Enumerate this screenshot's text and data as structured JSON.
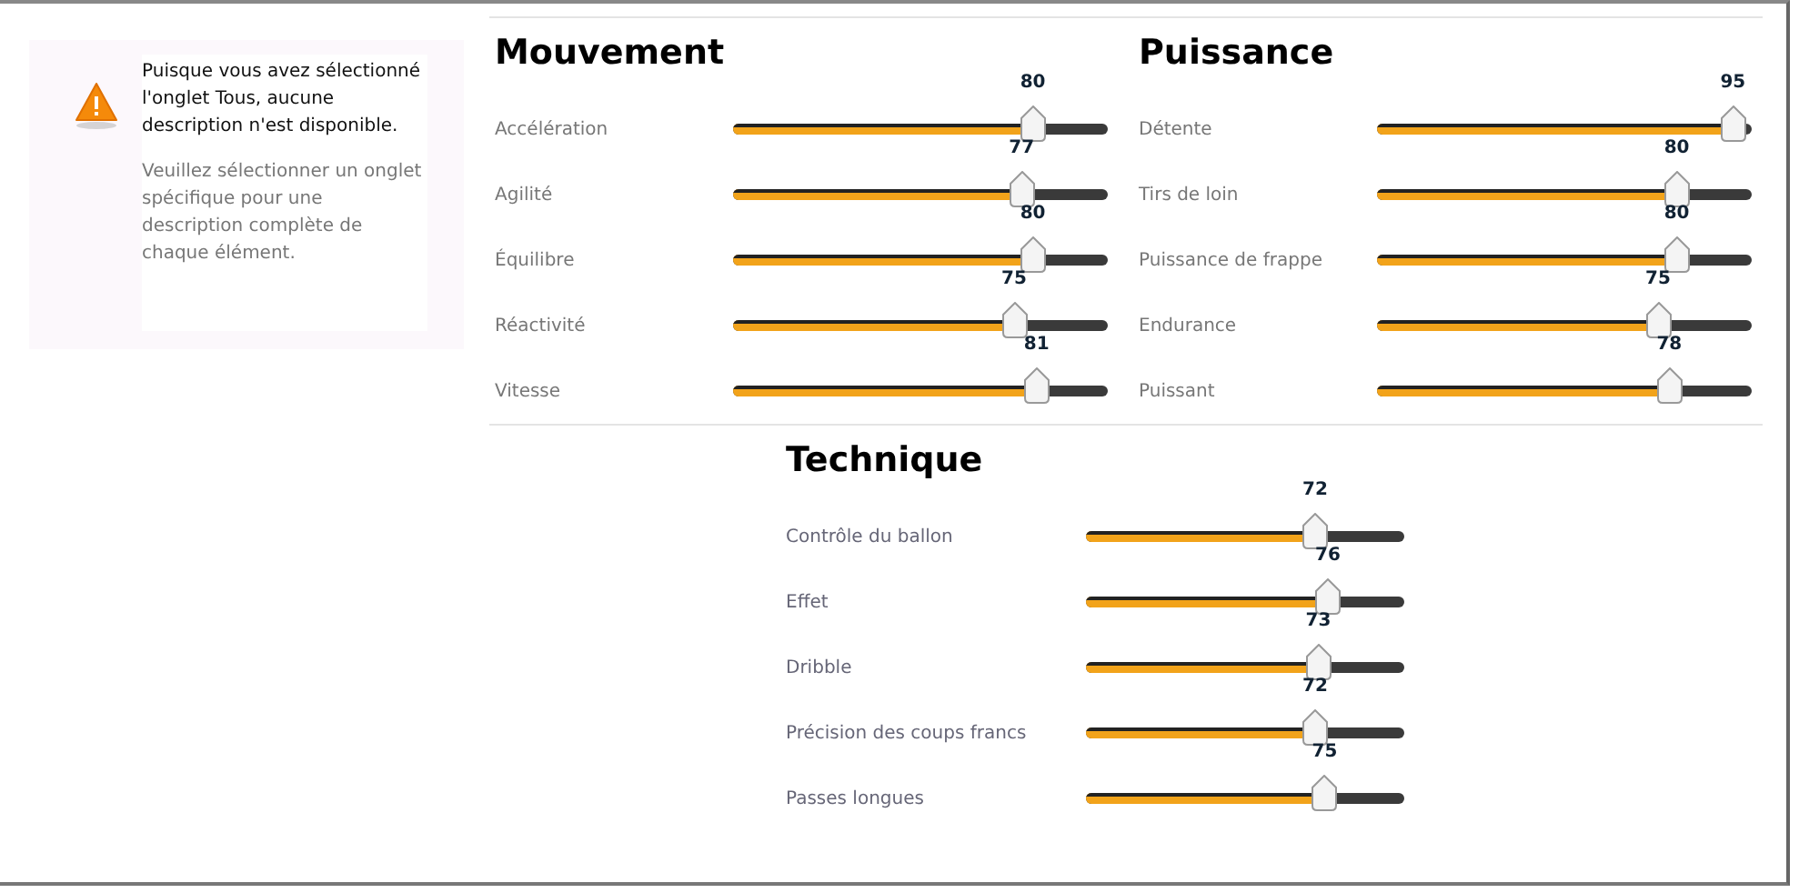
{
  "info": {
    "message": "Puisque vous avez sélectionné l'onglet Tous, aucune description n'est disponible.",
    "hint": "Veuillez sélectionner un onglet spécifique pour une description complète de chaque élément."
  },
  "sections": [
    {
      "title": "Mouvement",
      "stats": [
        {
          "name": "Accélération",
          "value": "80",
          "level": 0.8
        },
        {
          "name": "Agilité",
          "value": "77",
          "level": 0.77
        },
        {
          "name": "Équilibre",
          "value": "80",
          "level": 0.8
        },
        {
          "name": "Réactivité",
          "value": "75",
          "level": 0.75
        },
        {
          "name": "Vitesse",
          "value": "81",
          "level": 0.81
        }
      ]
    },
    {
      "title": "Puissance",
      "stats": [
        {
          "name": "Détente",
          "value": "95",
          "level": 0.95
        },
        {
          "name": "Tirs de loin",
          "value": "80",
          "level": 0.8
        },
        {
          "name": "Puissance de frappe",
          "value": "80",
          "level": 0.8
        },
        {
          "name": "Endurance",
          "value": "75",
          "level": 0.75
        },
        {
          "name": "Puissant",
          "value": "78",
          "level": 0.78
        }
      ]
    },
    {
      "title": "Technique",
      "stats": [
        {
          "name": "Contrôle du ballon",
          "value": "72",
          "level": 0.72
        },
        {
          "name": "Effet",
          "value": "76",
          "level": 0.76
        },
        {
          "name": "Dribble",
          "value": "73",
          "level": 0.73
        },
        {
          "name": "Précision des coups francs",
          "value": "72",
          "level": 0.72
        },
        {
          "name": "Passes longues",
          "value": "75",
          "level": 0.75
        }
      ]
    }
  ]
}
